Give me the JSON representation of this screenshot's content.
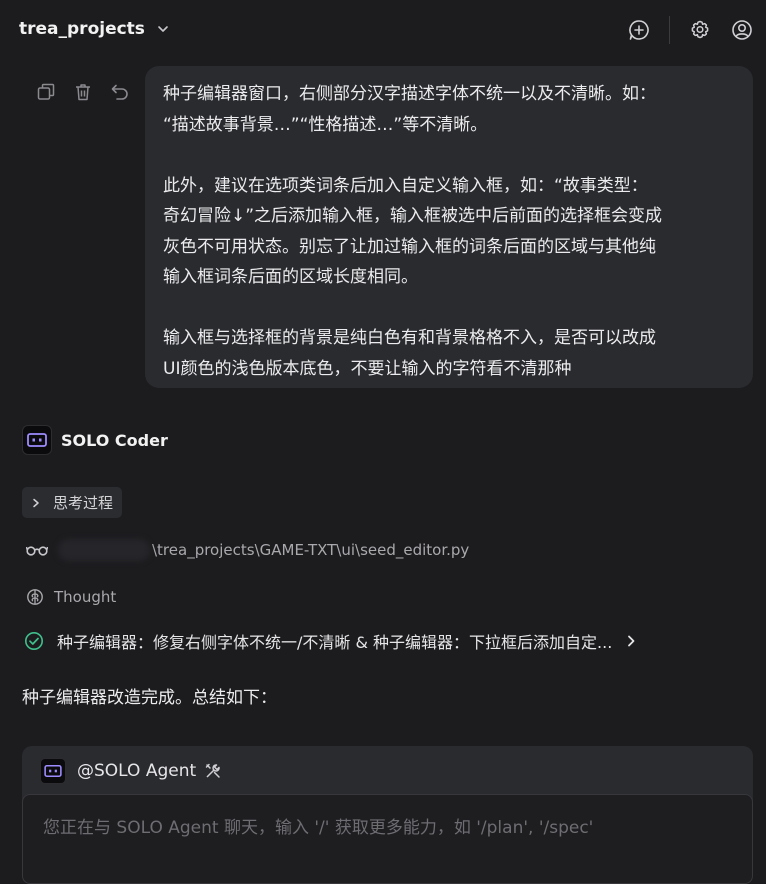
{
  "header": {
    "project": "trea_projects",
    "icons": [
      "new-chat-icon",
      "settings-icon",
      "account-icon"
    ]
  },
  "message": {
    "tools": [
      "copy-icon",
      "delete-icon",
      "undo-icon"
    ],
    "paragraphs": [
      "种子编辑器窗口，右侧部分汉字描述字体不统一以及不清晰。如：\n“描述故事背景…”“性格描述…”等不清晰。",
      "此外，建议在选项类词条后加入自定义输入框，如：“故事类型：\n奇幻冒险↓”之后添加输入框，输入框被选中后前面的选择框会变成\n灰色不可用状态。别忘了让加过输入框的词条后面的区域与其他纯\n输入框词条后面的区域长度相同。",
      "输入框与选择框的背景是纯白色有和背景格格不入，是否可以改成\nUI颜色的浅色版本底色，不要让输入的字符看不清那种"
    ]
  },
  "assistant": {
    "name": "SOLO Coder",
    "thinking_label": "思考过程",
    "file_path": "\\trea_projects\\GAME-TXT\\ui\\seed_editor.py",
    "thought_label": "Thought",
    "task_label": "种子编辑器：修复右侧字体不统一/不清晰 & 种子编辑器：下拉框后添加自定...",
    "summary": "种子编辑器改造完成。总结如下："
  },
  "composer": {
    "agent": "@SOLO Agent",
    "placeholder": "您正在与 SOLO Agent 聊天，输入 '/' 获取更多能力，如 '/plan', '/spec'"
  },
  "colors": {
    "background": "#1c1c1f",
    "bubble": "#2a2b2f",
    "success": "#3fbf8c",
    "logo_accent": "#9d8cff"
  }
}
